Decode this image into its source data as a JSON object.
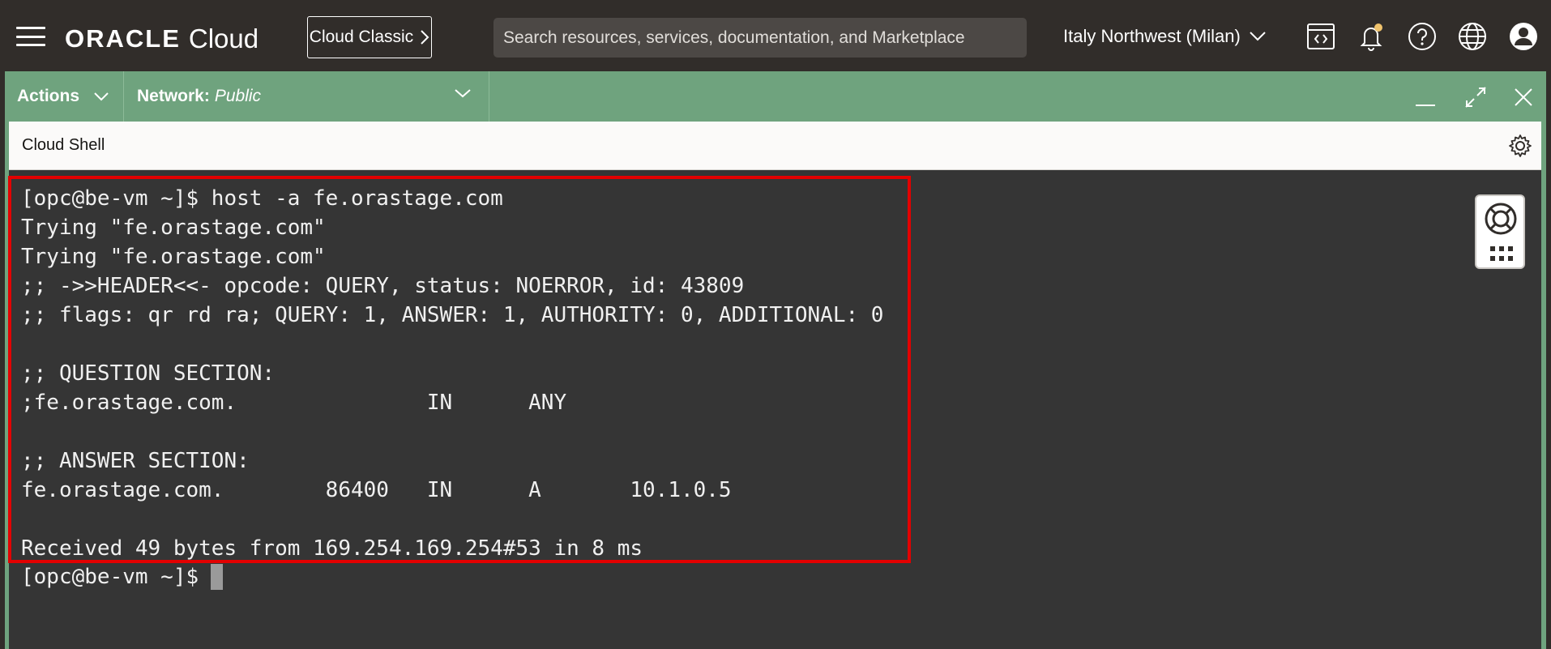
{
  "header": {
    "logo_oracle": "ORACLE",
    "logo_cloud": "Cloud",
    "classic_label": "Cloud Classic",
    "search_placeholder": "Search resources, services, documentation, and Marketplace",
    "region": "Italy Northwest (Milan)",
    "icons": [
      "developer-tools-icon",
      "bell-icon",
      "help-icon",
      "globe-icon",
      "user-icon"
    ],
    "notification_dot_color": "#f0c36d"
  },
  "actionbar": {
    "actions_label": "Actions",
    "network_label": "Network:",
    "network_value": "Public",
    "bar_color": "#6fa37e"
  },
  "shell": {
    "title": "Cloud Shell",
    "output_lines": [
      "[opc@be-vm ~]$ host -a fe.orastage.com",
      "Trying \"fe.orastage.com\"",
      "Trying \"fe.orastage.com\"",
      ";; ->>HEADER<<- opcode: QUERY, status: NOERROR, id: 43809",
      ";; flags: qr rd ra; QUERY: 1, ANSWER: 1, AUTHORITY: 0, ADDITIONAL: 0",
      "",
      ";; QUESTION SECTION:",
      ";fe.orastage.com.               IN      ANY",
      "",
      ";; ANSWER SECTION:",
      "fe.orastage.com.        86400   IN      A       10.1.0.5",
      "",
      "Received 49 bytes from 169.254.169.254#53 in 8 ms"
    ],
    "prompt": "[opc@be-vm ~]$",
    "highlight_color": "#e30000"
  }
}
